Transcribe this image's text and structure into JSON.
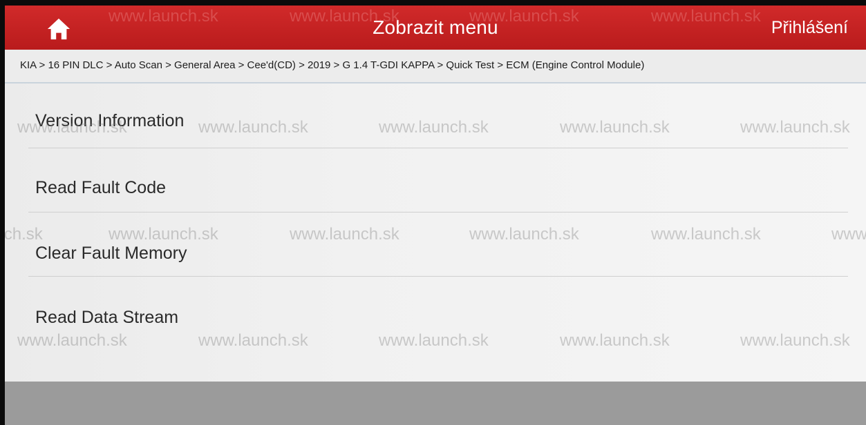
{
  "topbar": {
    "home_icon": "home-icon",
    "title": "Zobrazit menu",
    "login_label": "Přihlášení"
  },
  "breadcrumb": "KIA > 16 PIN DLC > Auto Scan > General Area > Cee'd(CD) > 2019 > G 1.4 T-GDI KAPPA > Quick Test > ECM (Engine Control Module)",
  "menu": {
    "items": [
      {
        "label": "Version Information"
      },
      {
        "label": "Read Fault Code"
      },
      {
        "label": "Clear Fault Memory"
      },
      {
        "label": "Read Data Stream"
      }
    ]
  },
  "watermark": "www.launch.sk"
}
